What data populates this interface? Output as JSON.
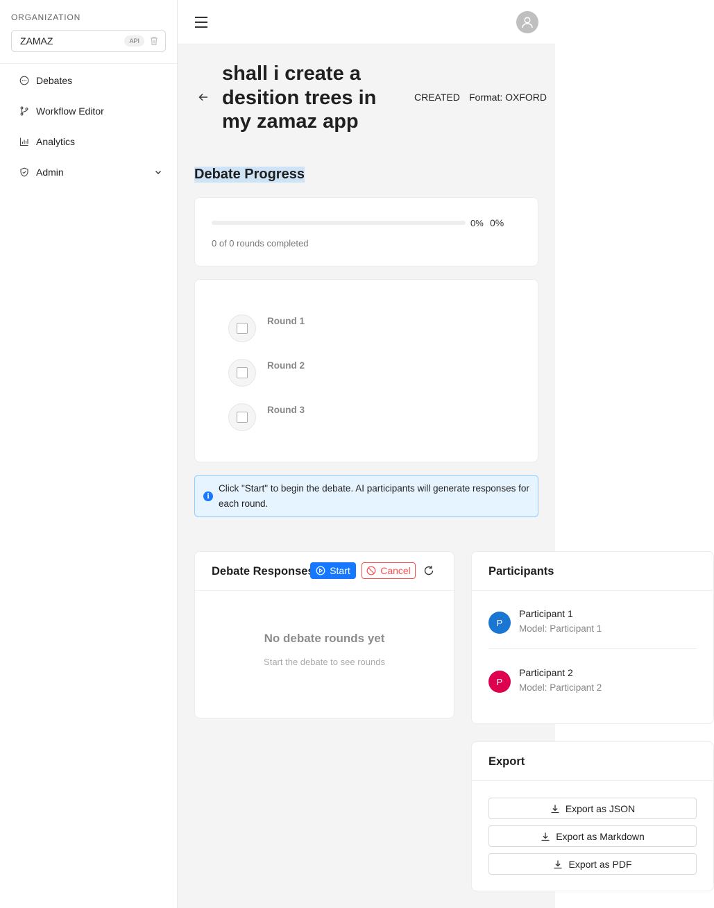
{
  "sidebar": {
    "org_label": "ORGANIZATION",
    "org_name": "ZAMAZ",
    "api_badge": "API",
    "items": [
      {
        "label": "Debates",
        "icon": "message-icon"
      },
      {
        "label": "Workflow Editor",
        "icon": "branch-icon"
      },
      {
        "label": "Analytics",
        "icon": "bar-chart-icon"
      },
      {
        "label": "Admin",
        "icon": "shield-icon"
      }
    ]
  },
  "header": {
    "menu_icon": "menu-icon",
    "avatar_icon": "user-icon"
  },
  "debate": {
    "title": "shall i create a desition trees in my zamaz app",
    "status": "CREATED",
    "format": "Format: OXFORD"
  },
  "progress": {
    "section_title": "Debate Progress",
    "percent": 0,
    "percent_label": "0%",
    "percent_label_2": "0%",
    "caption": "0 of 0 rounds completed"
  },
  "rounds": [
    {
      "label": "Round 1"
    },
    {
      "label": "Round 2"
    },
    {
      "label": "Round 3"
    }
  ],
  "info": {
    "text": "Click \"Start\" to begin the debate. AI participants will generate responses for each round."
  },
  "responses": {
    "title": "Debate Responses",
    "start_label": "Start",
    "cancel_label": "Cancel",
    "empty_title": "No debate rounds yet",
    "empty_subtitle": "Start the debate to see rounds"
  },
  "participants": {
    "title": "Participants",
    "list": [
      {
        "initial": "P",
        "name": "Participant 1",
        "model": "Model: Participant 1",
        "color": "#1976d2"
      },
      {
        "initial": "P",
        "name": "Participant 2",
        "model": "Model: Participant 2",
        "color": "#dc004e"
      }
    ]
  },
  "export": {
    "title": "Export",
    "json_label": "Export as JSON",
    "markdown_label": "Export as Markdown",
    "pdf_label": "Export as PDF"
  },
  "colors": {
    "primary": "#1677ff",
    "danger": "#ff4d4f",
    "info_bg": "#e6f4ff",
    "selection": "#cfe3f7"
  }
}
